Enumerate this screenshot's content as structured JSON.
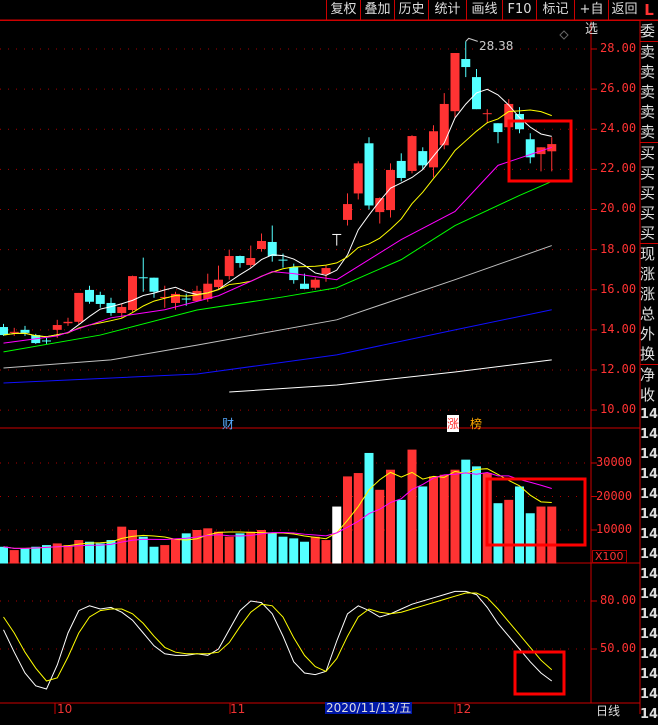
{
  "toolbar": {
    "buttons": [
      "复权",
      "叠加",
      "历史",
      "统计",
      "画线",
      "F10",
      "标记",
      "+自选",
      "返回"
    ],
    "corner": "L"
  },
  "price_axis": {
    "labels": [
      "28.00",
      "26.00",
      "24.00",
      "22.00",
      "20.00",
      "18.00",
      "16.00",
      "14.00",
      "12.00",
      "10.00"
    ],
    "values": [
      28,
      26,
      24,
      22,
      20,
      18,
      16,
      14,
      12,
      10
    ]
  },
  "volume_axis": {
    "labels": [
      "30000",
      "20000",
      "10000"
    ],
    "values": [
      30000,
      20000,
      10000
    ],
    "unit": "X100"
  },
  "kdj_axis": {
    "labels": [
      "80.00",
      "50.00"
    ],
    "values": [
      80,
      50
    ]
  },
  "side_panel": [
    "委",
    "卖",
    "卖",
    "卖",
    "卖",
    "卖",
    "买",
    "买",
    "买",
    "买",
    "买",
    "现",
    "涨",
    "涨",
    "总",
    "外",
    "换",
    "净",
    "收"
  ],
  "side_numbers": [
    "14",
    "14",
    "14",
    "14",
    "14",
    "14",
    "14",
    "14",
    "14",
    "14",
    "14",
    "14",
    "14",
    "14",
    "14",
    "14"
  ],
  "annotations": {
    "high_label": "28.38",
    "event_cai": "财",
    "event_zhang": "涨",
    "event_bang": "榜"
  },
  "x_axis": {
    "labels": [
      "10",
      "11",
      "12"
    ],
    "cursor_date": "2020/11/13/五",
    "period": "日线"
  },
  "colors": {
    "up": "#ff3333",
    "down": "#54ffff",
    "ma5": "#ffffff",
    "ma10": "#ffff00",
    "ma20": "#ff00ff",
    "ma30": "#00ff00",
    "ma60": "#c0c0c0",
    "ma120": "#1010ff",
    "ma250": "#ffffff",
    "highlight": "#ff0000"
  },
  "chart_data": {
    "type": "candlestick",
    "ohlc": [
      [
        14.14,
        14.3,
        13.7,
        13.74
      ],
      [
        13.9,
        14.1,
        13.7,
        13.9
      ],
      [
        14.0,
        14.2,
        13.7,
        13.85
      ],
      [
        13.74,
        13.8,
        13.3,
        13.34
      ],
      [
        13.47,
        13.6,
        13.3,
        13.46
      ],
      [
        14.0,
        14.5,
        13.6,
        14.24
      ],
      [
        14.33,
        14.6,
        14.2,
        14.4
      ],
      [
        14.4,
        15.84,
        14.3,
        15.84
      ],
      [
        15.99,
        16.2,
        15.3,
        15.4
      ],
      [
        15.74,
        15.9,
        15.1,
        15.29
      ],
      [
        15.34,
        15.6,
        14.7,
        14.84
      ],
      [
        14.84,
        15.3,
        14.6,
        15.14
      ],
      [
        14.99,
        16.7,
        14.9,
        16.68
      ],
      [
        16.62,
        17.6,
        15.9,
        16.6
      ],
      [
        16.6,
        16.6,
        15.6,
        15.9
      ],
      [
        15.62,
        16.2,
        15.1,
        15.64
      ],
      [
        15.34,
        15.9,
        15.0,
        15.79
      ],
      [
        15.56,
        15.8,
        15.2,
        15.54
      ],
      [
        15.44,
        16.2,
        15.4,
        15.94
      ],
      [
        15.54,
        16.8,
        15.4,
        16.3
      ],
      [
        16.13,
        17.2,
        16.0,
        16.5
      ],
      [
        16.68,
        18.0,
        16.5,
        17.68
      ],
      [
        17.68,
        17.7,
        17.1,
        17.33
      ],
      [
        17.23,
        18.2,
        17.1,
        17.58
      ],
      [
        18.03,
        18.8,
        17.9,
        18.43
      ],
      [
        18.38,
        19.2,
        17.4,
        17.68
      ],
      [
        17.5,
        17.8,
        17.1,
        17.48
      ],
      [
        17.13,
        17.3,
        16.3,
        16.48
      ],
      [
        16.3,
        16.8,
        16.04,
        16.04
      ],
      [
        16.1,
        16.6,
        16.0,
        16.5
      ],
      [
        16.78,
        17.2,
        16.4,
        17.08
      ],
      [
        18.78,
        18.78,
        18.2,
        18.78
      ],
      [
        19.48,
        20.8,
        19.2,
        20.27
      ],
      [
        20.8,
        22.4,
        20.5,
        22.3
      ],
      [
        23.3,
        23.6,
        20.0,
        20.2
      ],
      [
        19.87,
        20.6,
        19.3,
        20.57
      ],
      [
        19.97,
        22.3,
        19.6,
        21.97
      ],
      [
        22.42,
        22.8,
        21.4,
        21.57
      ],
      [
        21.92,
        23.7,
        21.8,
        23.66
      ],
      [
        22.91,
        23.1,
        22.0,
        22.2
      ],
      [
        22.1,
        24.2,
        21.6,
        23.9
      ],
      [
        23.2,
        25.8,
        23.0,
        25.26
      ],
      [
        24.9,
        27.8,
        24.6,
        27.8
      ],
      [
        27.5,
        28.38,
        26.6,
        27.1
      ],
      [
        26.6,
        27.0,
        25.0,
        25.0
      ],
      [
        24.78,
        25.0,
        24.3,
        24.8
      ],
      [
        24.3,
        24.3,
        23.3,
        23.86
      ],
      [
        24.1,
        25.5,
        24.0,
        25.26
      ],
      [
        24.76,
        25.1,
        23.8,
        24.0
      ],
      [
        23.5,
        23.8,
        22.3,
        22.6
      ],
      [
        22.76,
        23.1,
        21.9,
        23.1
      ],
      [
        22.9,
        23.6,
        21.9,
        23.26
      ]
    ],
    "ma_lines": {
      "ma20": [
        [
          0,
          13.34
        ],
        [
          5,
          13.7
        ],
        [
          10,
          14.6
        ],
        [
          15,
          15.0
        ],
        [
          20,
          15.7
        ],
        [
          25,
          16.9
        ],
        [
          27,
          16.8
        ],
        [
          31,
          16.5
        ],
        [
          37,
          18.5
        ],
        [
          42,
          19.9
        ],
        [
          46,
          22.2
        ],
        [
          51,
          23.1
        ]
      ],
      "ma30": [
        [
          0,
          12.9
        ],
        [
          9,
          13.74
        ],
        [
          18,
          14.99
        ],
        [
          26,
          15.64
        ],
        [
          31,
          16.1
        ],
        [
          37,
          17.5
        ],
        [
          42,
          19.2
        ],
        [
          48,
          20.7
        ],
        [
          51,
          21.4
        ]
      ],
      "ma60": [
        [
          0,
          12.1
        ],
        [
          10,
          12.5
        ],
        [
          18,
          13.24
        ],
        [
          31,
          14.5
        ],
        [
          42,
          16.5
        ],
        [
          51,
          18.2
        ]
      ],
      "ma120": [
        [
          0,
          11.35
        ],
        [
          18,
          11.8
        ],
        [
          31,
          12.75
        ],
        [
          42,
          14.0
        ],
        [
          51,
          15.0
        ]
      ],
      "ma250": [
        [
          21,
          10.9
        ],
        [
          31,
          11.25
        ],
        [
          42,
          11.9
        ],
        [
          51,
          12.5
        ]
      ]
    },
    "volume": [
      5000,
      4000,
      4500,
      5000,
      5500,
      6000,
      5500,
      7000,
      6500,
      6000,
      7000,
      11000,
      10000,
      8000,
      5000,
      5500,
      7500,
      9000,
      10000,
      10500,
      9500,
      8000,
      9000,
      9500,
      10000,
      9000,
      8000,
      7500,
      6500,
      8000,
      7000,
      17000,
      26000,
      27000,
      33000,
      22000,
      28000,
      19000,
      34000,
      23000,
      26000,
      26500,
      28000,
      31000,
      29000,
      27000,
      18000,
      19000,
      23000,
      15000,
      17000,
      17000
    ],
    "kdj_k": [
      62,
      48,
      35,
      27,
      25,
      40,
      60,
      74,
      77,
      75,
      76,
      73,
      68,
      60,
      52,
      47,
      46,
      46,
      47,
      46,
      50,
      62,
      74,
      80,
      79,
      72,
      58,
      42,
      35,
      34,
      36,
      55,
      72,
      77,
      74,
      70,
      72,
      75,
      78,
      80,
      82,
      84,
      86,
      86,
      84,
      76,
      66,
      58,
      50,
      42,
      35,
      30
    ],
    "kdj_d": [
      70,
      60,
      48,
      38,
      30,
      32,
      45,
      60,
      70,
      74,
      75,
      75,
      72,
      66,
      58,
      51,
      48,
      47,
      47,
      47,
      48,
      54,
      64,
      73,
      78,
      77,
      70,
      57,
      46,
      39,
      36,
      44,
      58,
      70,
      75,
      73,
      72,
      73,
      75,
      77,
      79,
      81,
      83,
      85,
      85,
      82,
      75,
      67,
      59,
      51,
      43,
      37
    ],
    "price_ylim": [
      10,
      28
    ],
    "volume_ylim": [
      0,
      30000
    ],
    "kdj_ylim": [
      50,
      80
    ]
  }
}
